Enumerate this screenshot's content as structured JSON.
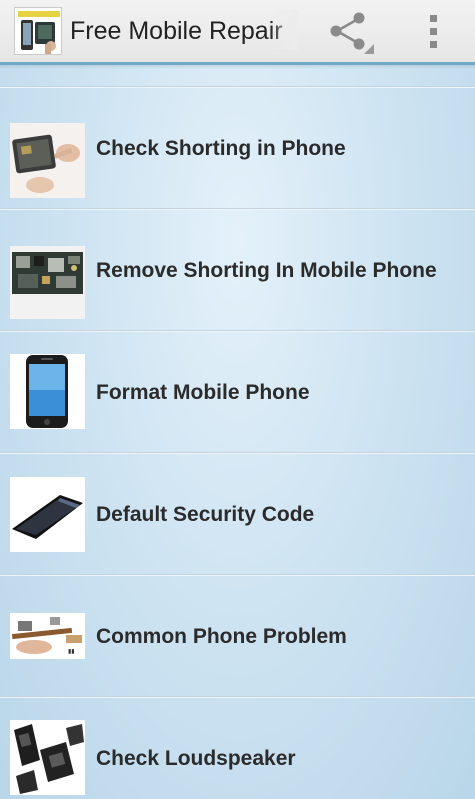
{
  "action_bar": {
    "title": "Free Mobile Repair",
    "icon": "app-logo-icon",
    "actions": [
      {
        "name": "share",
        "icon": "share-icon"
      },
      {
        "name": "more",
        "icon": "overflow-menu-icon"
      }
    ]
  },
  "list": {
    "items": [
      {
        "label": "Check Shorting in Phone",
        "icon": "phone-repair-thumbnail"
      },
      {
        "label": "Remove Shorting In Mobile Phone",
        "icon": "circuit-board-thumbnail"
      },
      {
        "label": "Format Mobile Phone",
        "icon": "smartphone-thumbnail"
      },
      {
        "label": "Default Security Code",
        "icon": "phone-side-thumbnail"
      },
      {
        "label": "Common Phone Problem",
        "icon": "flex-cable-thumbnail"
      },
      {
        "label": "Check Loudspeaker",
        "icon": "loudspeaker-thumbnail"
      }
    ]
  },
  "colors": {
    "action_bar_bg": "#e9e9e9",
    "action_bar_accent": "#6fa9c7",
    "background": "#cfe4f2",
    "text": "#2b2b2b"
  }
}
